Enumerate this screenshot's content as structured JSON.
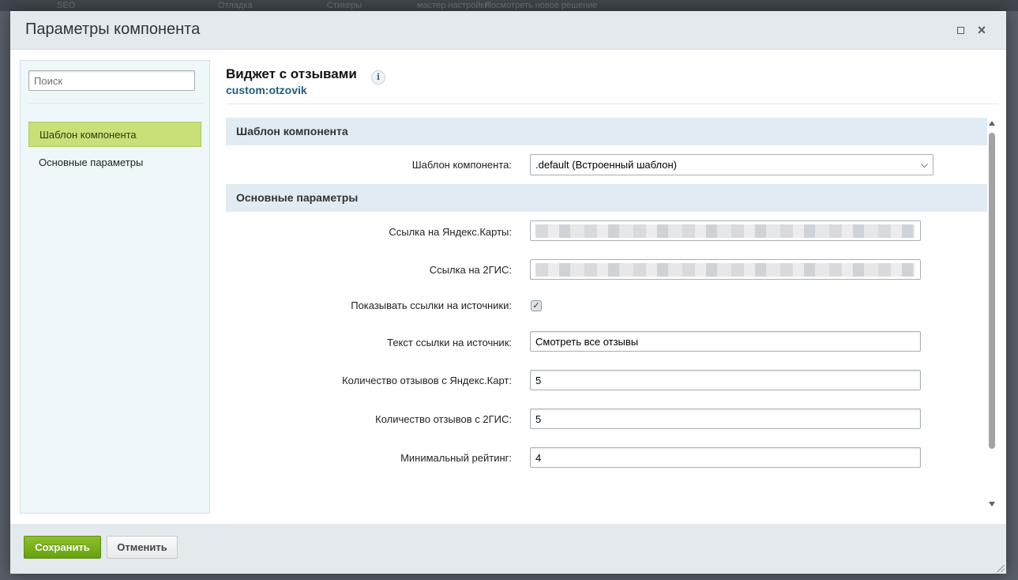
{
  "background_toolbar": {
    "items": [
      "SEO",
      "Отладка",
      "Стикеры",
      "мастер настройки",
      "Посмотреть новое решение"
    ]
  },
  "dialog": {
    "title": "Параметры компонента",
    "maximize_icon": "maximize-icon",
    "close_icon": "close-icon",
    "close_glyph": "×"
  },
  "sidebar": {
    "search_placeholder": "Поиск",
    "items": [
      {
        "label": "Шаблон компонента",
        "active": true
      },
      {
        "label": "Основные параметры",
        "active": false
      }
    ]
  },
  "component": {
    "title": "Виджет с отзывами",
    "code": "custom:otzovik",
    "info_glyph": "i"
  },
  "sections": {
    "template": {
      "title": "Шаблон компонента",
      "template_label": "Шаблон компонента:",
      "template_value": ".default (Встроенный шаблон)"
    },
    "main": {
      "title": "Основные параметры",
      "yandex_link_label": "Ссылка на Яндекс.Карты:",
      "gis_link_label": "Ссылка на 2ГИС:",
      "show_links_label": "Показывать ссылки на источники:",
      "show_links_checked": true,
      "source_text_label": "Текст ссылки на источник:",
      "source_text_value": "Смотреть все отзывы",
      "yandex_count_label": "Количество отзывов с Яндекс.Карт:",
      "yandex_count_value": "5",
      "gis_count_label": "Количество отзывов с 2ГИС:",
      "gis_count_value": "5",
      "min_rating_label": "Минимальный рейтинг:",
      "min_rating_value": "4"
    }
  },
  "footer": {
    "save_label": "Сохранить",
    "cancel_label": "Отменить"
  },
  "colors": {
    "save_button": "#6aa816",
    "active_nav": "#c9df77",
    "section_header": "#e1ebf3",
    "component_code": "#1d5e7e"
  }
}
